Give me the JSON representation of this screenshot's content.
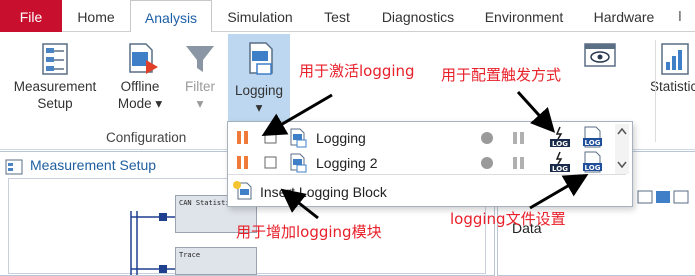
{
  "tabs": [
    {
      "label": "File"
    },
    {
      "label": "Home"
    },
    {
      "label": "Analysis"
    },
    {
      "label": "Simulation"
    },
    {
      "label": "Test"
    },
    {
      "label": "Diagnostics"
    },
    {
      "label": "Environment"
    },
    {
      "label": "Hardware"
    }
  ],
  "ribbon": {
    "measurement_setup": {
      "line1": "Measurement",
      "line2": "Setup"
    },
    "offline_mode": {
      "line1": "Offline",
      "line2": "Mode ▾"
    },
    "filter": {
      "line1": "Filter",
      "line2": "▾"
    },
    "logging": {
      "line1": "Logging",
      "line2": "▾"
    },
    "statistics": {
      "line1": "Statistic"
    },
    "group_configuration": "Configuration"
  },
  "dropdown": {
    "rows": [
      {
        "label": "Logging"
      },
      {
        "label": "Logging 2"
      }
    ],
    "log_badge": "LOG",
    "insert_label": "Insert Logging Block"
  },
  "panel": {
    "title": "Measurement Setup",
    "block1": "CAN Statisti",
    "block2": "Trace",
    "right_partial": "Data"
  },
  "annotations": {
    "activate": "用于激活logging",
    "trigger": "用于配置触发方式",
    "add_block": "用于增加logging模块",
    "file_settings": "logging文件设置"
  },
  "colors": {
    "accent_blue": "#1d5fa8",
    "file_tab_red": "#c8102e",
    "annotation_red": "#e8202a",
    "pressed_blue": "#bcd7ef",
    "pause_orange": "#f07a3a"
  }
}
